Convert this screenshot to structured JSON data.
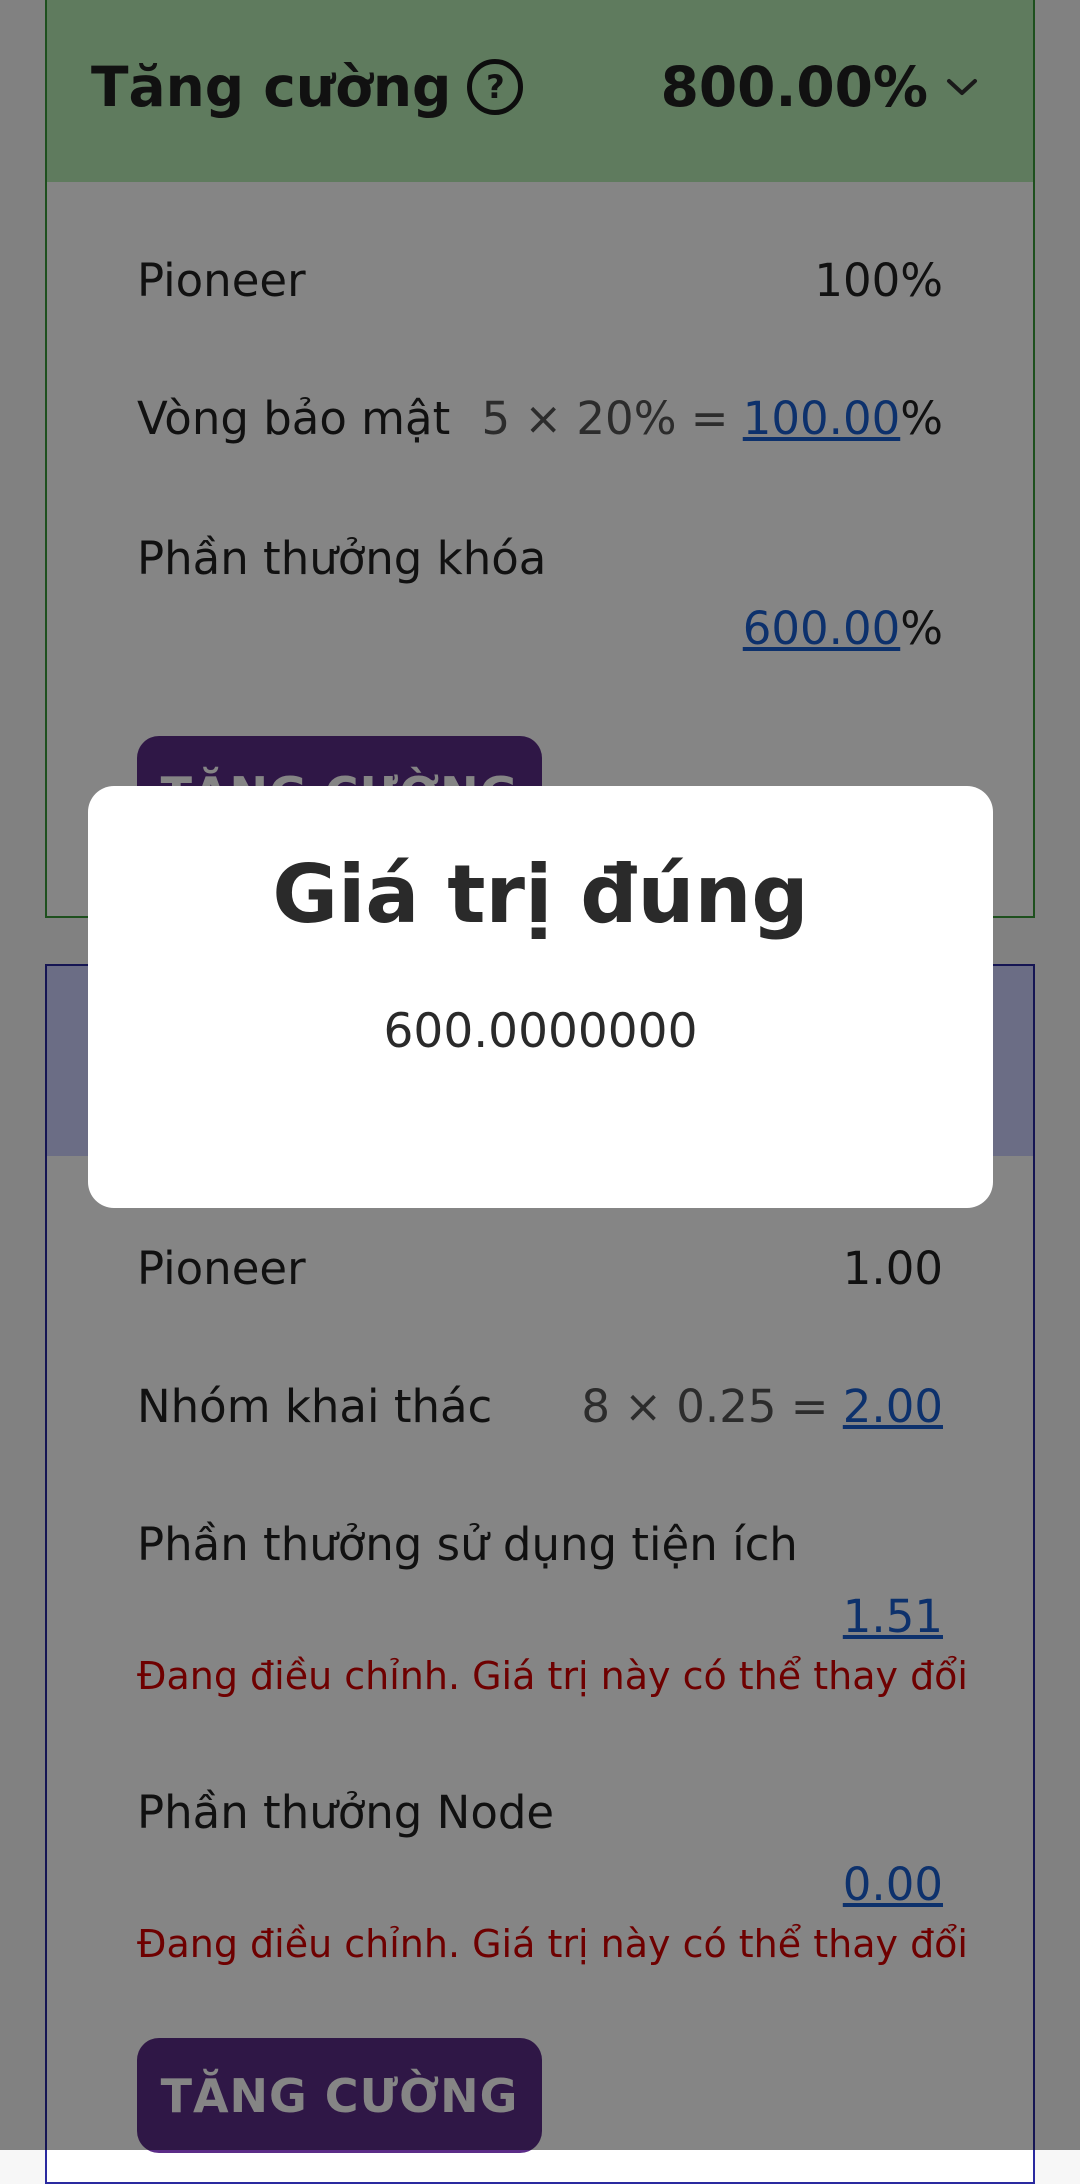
{
  "boost_card": {
    "title": "Tăng cường",
    "help_icon": "?",
    "total": "800.00%",
    "rows": [
      {
        "label": "Pioneer",
        "value": "100%"
      },
      {
        "label": "Vòng bảo mật",
        "calc": "5 × 20% = ",
        "link": "100.00",
        "suffix": "%"
      },
      {
        "label": "Phần thưởng khóa",
        "link": "600.00",
        "suffix": "%"
      }
    ],
    "button_label": "TĂNG CƯỜNG"
  },
  "mining_card": {
    "rows": [
      {
        "label": "Pioneer",
        "value": "1.00"
      },
      {
        "label": "Nhóm khai thác",
        "calc": "8 × 0.25 = ",
        "link": "2.00"
      },
      {
        "label": "Phần thưởng sử dụng tiện ích",
        "link": "1.51",
        "warning": "Đang điều chỉnh. Giá trị này có thể thay đổi"
      },
      {
        "label": "Phần thưởng Node",
        "link": "0.00",
        "warning": "Đang điều chỉnh. Giá trị này có thể thay đổi"
      }
    ],
    "button_label": "TĂNG CƯỜNG"
  },
  "modal": {
    "title": "Giá trị đúng",
    "value": "600.0000000"
  }
}
